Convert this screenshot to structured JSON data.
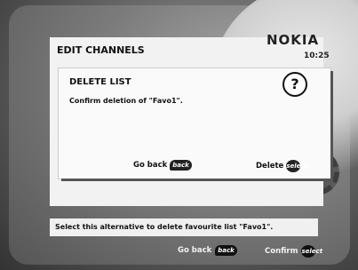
{
  "header": {
    "title": "EDIT CHANNELS",
    "brand": "NOKIA",
    "time": "10:25"
  },
  "dialog": {
    "title": "DELETE LIST",
    "help_icon": "?",
    "message": "Confirm deletion of \"Favo1\".",
    "go_back_label": "Go back",
    "go_back_key": "back",
    "delete_label": "Delete",
    "delete_key": "select"
  },
  "status": {
    "text": "Select this alternative to delete favourite list \"Favo1\"."
  },
  "bottom": {
    "go_back_label": "Go back",
    "go_back_key": "back",
    "confirm_label": "Confirm",
    "confirm_key": "select"
  }
}
